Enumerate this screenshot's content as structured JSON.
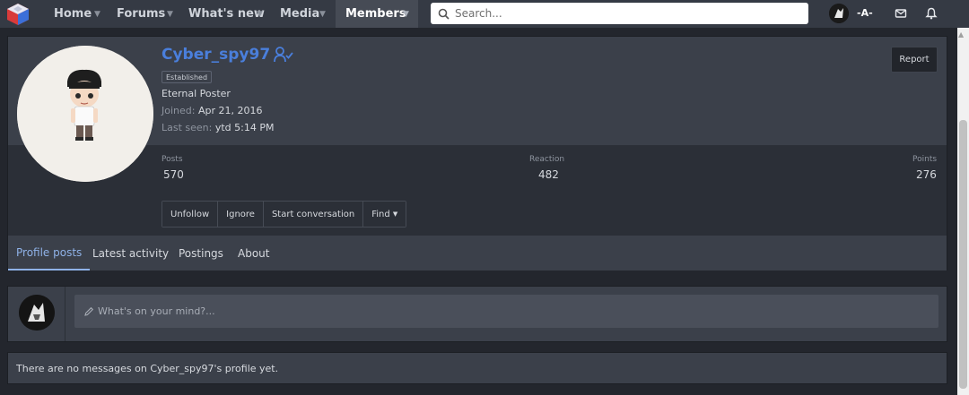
{
  "nav": {
    "items": [
      {
        "label": "Home"
      },
      {
        "label": "Forums"
      },
      {
        "label": "What's new"
      },
      {
        "label": "Media"
      },
      {
        "label": "Members"
      }
    ],
    "search_placeholder": "Search...",
    "user_short": "-A-"
  },
  "profile": {
    "username": "Cyber_spy97",
    "badge": "Established",
    "title": "Eternal Poster",
    "joined_label": "Joined:",
    "joined_value": "Apr 21, 2016",
    "lastseen_label": "Last seen:",
    "lastseen_value": "ytd 5:14 PM",
    "report_label": "Report",
    "stats": [
      {
        "label": "Posts",
        "value": "570"
      },
      {
        "label": "Reaction",
        "value": "482"
      },
      {
        "label": "Points",
        "value": "276"
      }
    ],
    "actions": [
      "Unfollow",
      "Ignore",
      "Start conversation",
      "Find"
    ]
  },
  "tabs": [
    "Profile posts",
    "Latest activity",
    "Postings",
    "About"
  ],
  "post_placeholder": "What's on your mind?...",
  "empty_message": "There are no messages on Cyber_spy97's profile yet.",
  "colors": {
    "accent": "#4a7fdc",
    "active_tab": "#8fb2e8",
    "topbar": "#353a44"
  }
}
